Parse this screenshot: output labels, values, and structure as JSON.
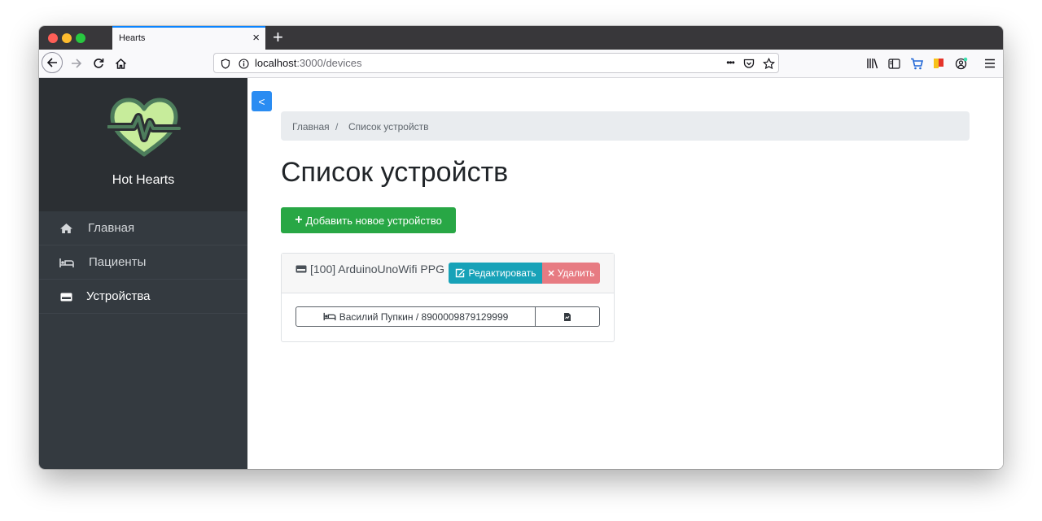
{
  "browser": {
    "tab_title": "Hearts",
    "url_host": "localhost",
    "url_rest": ":3000/devices",
    "new_tab": "+",
    "close_tab": "×",
    "page_actions": "•••"
  },
  "sidebar": {
    "brand": "Hot Hearts",
    "toggle_label": "<",
    "items": [
      {
        "label": "Главная",
        "icon": "home-icon"
      },
      {
        "label": "Пациенты",
        "icon": "bed-icon"
      },
      {
        "label": "Устройства",
        "icon": "device-icon",
        "active": true
      }
    ]
  },
  "breadcrumb": {
    "items": [
      "Главная",
      "Список устройств"
    ],
    "separator": "/"
  },
  "main": {
    "title": "Список устройств",
    "add_button": "Добавить новое устройство",
    "add_icon": "+"
  },
  "devices": [
    {
      "label": "[100] ArduinoUnoWifi PPG",
      "edit_label": "Редактировать",
      "delete_label": "Удалить",
      "delete_icon": "✕",
      "patient": "Василий Пупкин / 8900009879129999"
    }
  ],
  "colors": {
    "sidebar": "#343a40",
    "success": "#28a745",
    "info": "#17a2b8",
    "danger": "#e77b82",
    "primary": "#2a8cf2"
  }
}
